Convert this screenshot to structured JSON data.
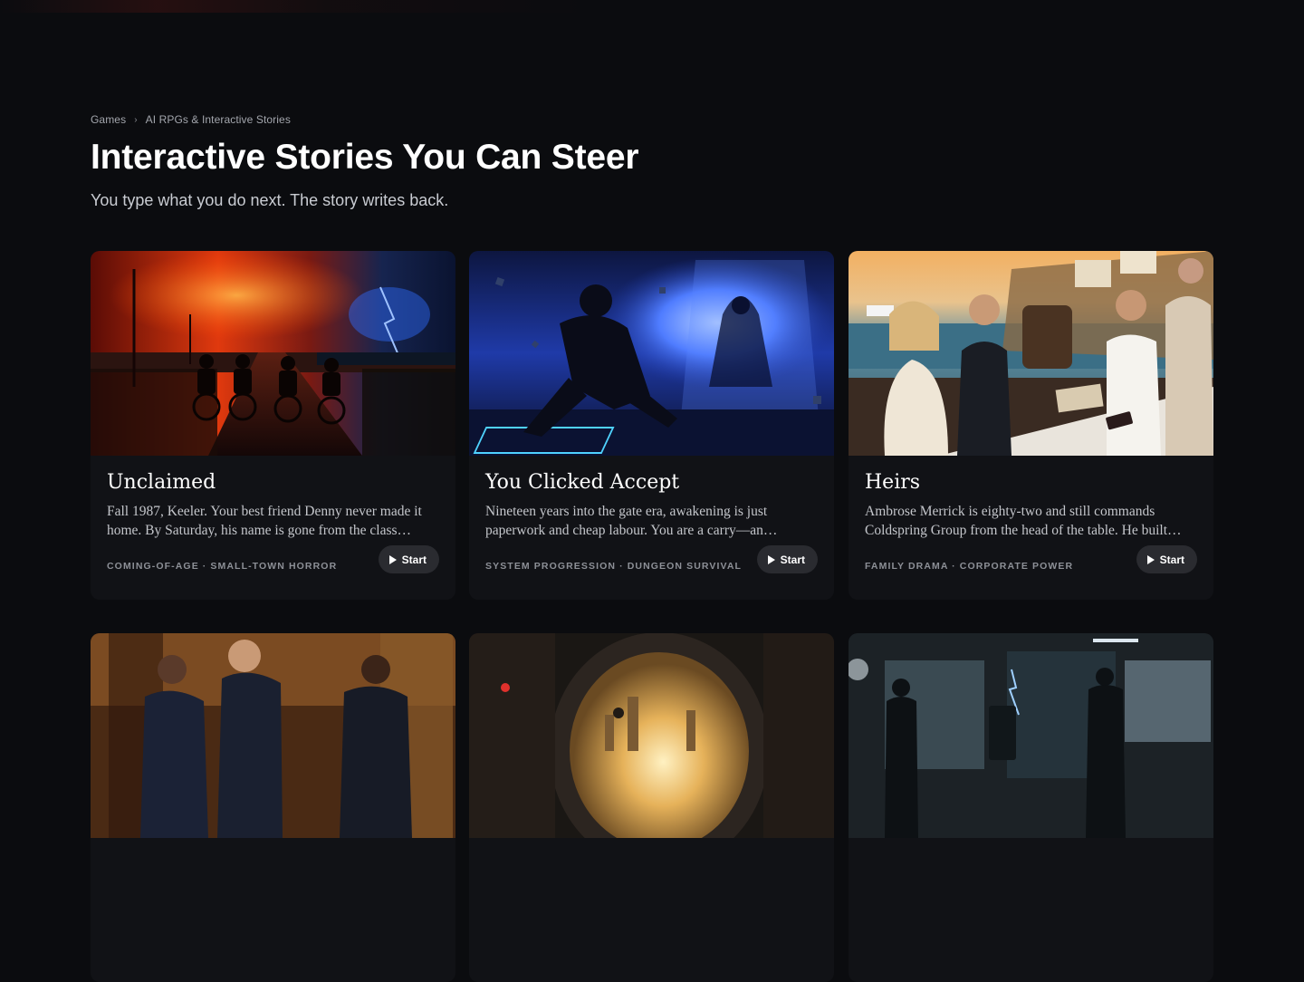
{
  "breadcrumb": {
    "items": [
      "Games",
      "AI RPGs & Interactive Stories"
    ],
    "separator": "›"
  },
  "header": {
    "title": "Interactive Stories You Can Steer",
    "subtitle": "You type what you do next. The story writes back."
  },
  "cards": [
    {
      "title": "Unclaimed",
      "description": "Fall 1987, Keeler. Your best friend Denny never made it home. By Saturday, his name is gone from the class…",
      "tags": "COMING-OF-AGE · SMALL-TOWN HORROR",
      "button_label": "Start"
    },
    {
      "title": "You Clicked Accept",
      "description": "Nineteen years into the gate era, awakening is just paperwork and cheap labour. You are a carry—an…",
      "tags": "SYSTEM PROGRESSION · DUNGEON SURVIVAL",
      "button_label": "Start"
    },
    {
      "title": "Heirs",
      "description": "Ambrose Merrick is eighty-two and still commands Coldspring Group from the head of the table. He built…",
      "tags": "FAMILY DRAMA · CORPORATE POWER",
      "button_label": "Start"
    },
    {
      "title": "",
      "description": "",
      "tags": "",
      "button_label": ""
    },
    {
      "title": "",
      "description": "",
      "tags": "",
      "button_label": ""
    },
    {
      "title": "",
      "description": "",
      "tags": "",
      "button_label": ""
    }
  ],
  "icons": {
    "start": "play-icon",
    "separator": "chevron-right-icon"
  },
  "colors": {
    "background": "#0b0c0f",
    "card": "#111216",
    "button": "#2a2b30"
  }
}
